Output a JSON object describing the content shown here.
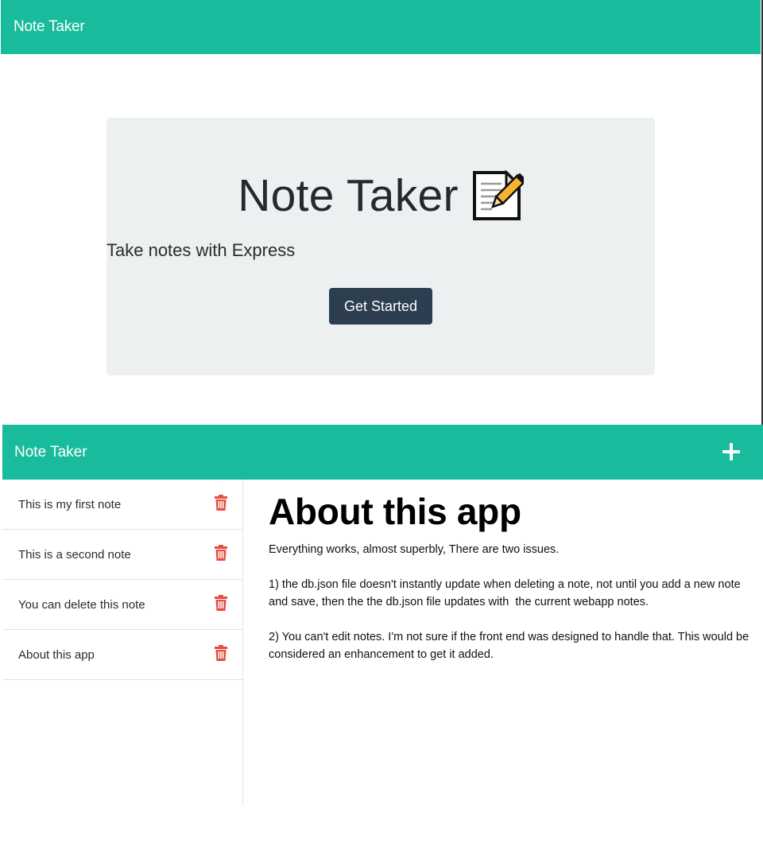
{
  "landing": {
    "navbar": {
      "brand": "Note Taker"
    },
    "jumbotron": {
      "title": "Note Taker",
      "icon": "memo-icon",
      "lead": "Take notes with Express",
      "button_label": "Get Started"
    }
  },
  "notes_page": {
    "navbar": {
      "brand": "Note Taker",
      "new_note_icon": "plus-icon"
    },
    "notes": [
      {
        "title": "This is my first note",
        "delete_icon": "trash-icon"
      },
      {
        "title": "This is a second note",
        "delete_icon": "trash-icon"
      },
      {
        "title": "You can delete this note",
        "delete_icon": "trash-icon"
      },
      {
        "title": "About this app",
        "delete_icon": "trash-icon"
      }
    ],
    "active_note": {
      "title": "About this app",
      "text": "Everything works, almost superbly, There are two issues.\n\n1) the db.json file doesn't instantly update when deleting a note, not until you add a new note and save, then the the db.json file updates with  the current webapp notes.\n\n2) You can't edit notes. I'm not sure if the front end was designed to handle that. This would be considered an enhancement to get it added."
    }
  },
  "colors": {
    "navbar": "#18bc9c",
    "jumbotron": "#ecf0f1",
    "button": "#2c3e50",
    "trash": "#e74c3c"
  }
}
